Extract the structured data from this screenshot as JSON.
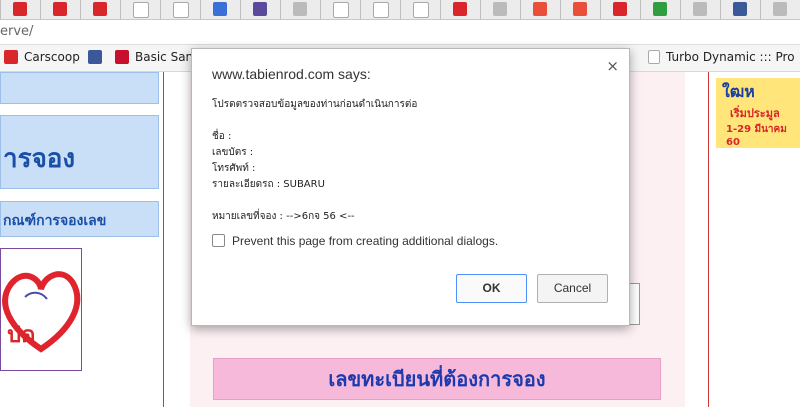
{
  "tabs": [
    {
      "icon": "red-c-icon",
      "color": "#d8262a"
    },
    {
      "icon": "red-c-icon",
      "color": "#d8262a"
    },
    {
      "icon": "red-c-icon",
      "color": "#d8262a"
    },
    {
      "icon": "wikipedia-icon",
      "color": "#ffffff"
    },
    {
      "icon": "wikipedia-icon",
      "color": "#ffffff"
    },
    {
      "icon": "blue-paren-icon",
      "color": "#3b6fd8"
    },
    {
      "icon": "purple-ww-icon",
      "color": "#5b4a9b"
    },
    {
      "icon": "grey-circle-icon",
      "color": "#bbbbbb"
    },
    {
      "icon": "wikipedia-icon",
      "color": "#ffffff"
    },
    {
      "icon": "wikipedia-icon",
      "color": "#ffffff"
    },
    {
      "icon": "blank-page-icon",
      "color": "#ffffff"
    },
    {
      "icon": "red-c-icon",
      "color": "#d8262a"
    },
    {
      "icon": "grey-circle-icon",
      "color": "#bbbbbb"
    },
    {
      "icon": "red-g-icon",
      "color": "#e8503a"
    },
    {
      "icon": "red-g-icon",
      "color": "#e8503a"
    },
    {
      "icon": "red-c-icon",
      "color": "#d8262a"
    },
    {
      "icon": "green-cr-icon",
      "color": "#2e9e3e"
    },
    {
      "icon": "grey-circle-icon",
      "color": "#bbbbbb"
    },
    {
      "icon": "facebook-icon",
      "color": "#3b5998"
    },
    {
      "icon": "grey-circle-icon",
      "color": "#bbbbbb"
    }
  ],
  "address": {
    "url_fragment": "erve/"
  },
  "bookmarks": [
    {
      "label": "Carscoop",
      "icon": "carscoop-icon",
      "color": "#d8262a"
    },
    {
      "label": "",
      "icon": "facebook-icon",
      "color": "#3b5998"
    },
    {
      "label": "Basic Sans",
      "icon": "basic-sans-icon",
      "color": "#c8102e"
    },
    {
      "label": "Turbo Dynamic ::: Pro",
      "icon": "page-icon",
      "color": "#ffffff"
    }
  ],
  "page": {
    "box_top_text": "",
    "box_reserve_text": "ารจอง",
    "box_criteria_text": "กณฑ์การจองเลข",
    "banner_text": "เลขทะเบียนที่ต้องการจอง",
    "heart_logo_text": "ปด",
    "ad_text_1": "ใฒห",
    "ad_text_2": "เริ่มประมูล",
    "ad_text_3": "1-29 มีนาคม 60"
  },
  "dialog": {
    "title": "www.tabienrod.com says:",
    "line_intro": "โปรดตรวจสอบข้อมูลของท่านก่อนดำเนินการต่อ",
    "line_name": "ชื่อ :",
    "line_id": "เลขบัตร :",
    "line_phone": "โทรศัพท์ :",
    "line_car": "รายละเอียดรถ : SUBARU",
    "line_plate": "หมายเลขที่จอง : -->6กจ 56 <--",
    "checkbox_label": "Prevent this page from creating additional dialogs.",
    "ok_label": "OK",
    "cancel_label": "Cancel",
    "close_glyph": "×"
  },
  "colors": {
    "accent_blue": "#4d90fe",
    "header_blue": "#1a4fa8",
    "pink_banner": "#f7b9d9"
  }
}
